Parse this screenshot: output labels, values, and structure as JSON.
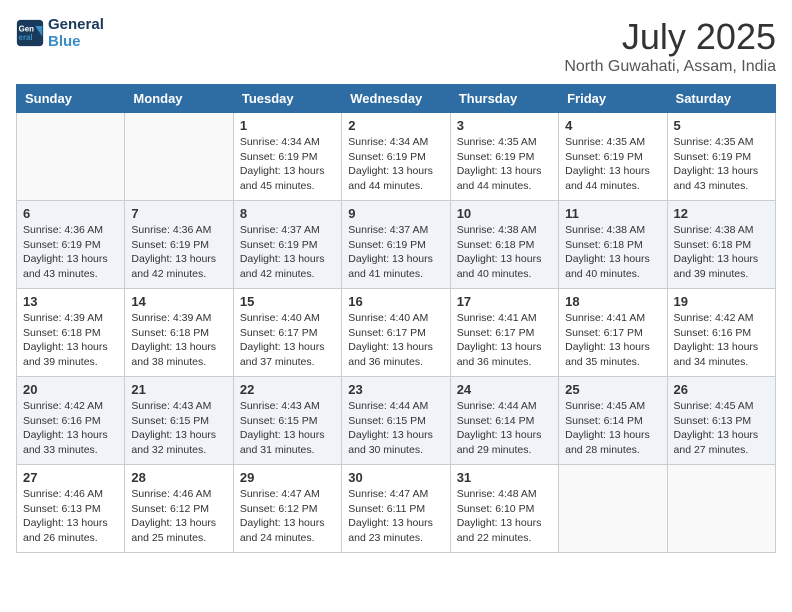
{
  "logo": {
    "line1": "General",
    "line2": "Blue"
  },
  "title": "July 2025",
  "subtitle": "North Guwahati, Assam, India",
  "weekdays": [
    "Sunday",
    "Monday",
    "Tuesday",
    "Wednesday",
    "Thursday",
    "Friday",
    "Saturday"
  ],
  "weeks": [
    [
      {
        "day": "",
        "info": ""
      },
      {
        "day": "",
        "info": ""
      },
      {
        "day": "1",
        "info": "Sunrise: 4:34 AM\nSunset: 6:19 PM\nDaylight: 13 hours and 45 minutes."
      },
      {
        "day": "2",
        "info": "Sunrise: 4:34 AM\nSunset: 6:19 PM\nDaylight: 13 hours and 44 minutes."
      },
      {
        "day": "3",
        "info": "Sunrise: 4:35 AM\nSunset: 6:19 PM\nDaylight: 13 hours and 44 minutes."
      },
      {
        "day": "4",
        "info": "Sunrise: 4:35 AM\nSunset: 6:19 PM\nDaylight: 13 hours and 44 minutes."
      },
      {
        "day": "5",
        "info": "Sunrise: 4:35 AM\nSunset: 6:19 PM\nDaylight: 13 hours and 43 minutes."
      }
    ],
    [
      {
        "day": "6",
        "info": "Sunrise: 4:36 AM\nSunset: 6:19 PM\nDaylight: 13 hours and 43 minutes."
      },
      {
        "day": "7",
        "info": "Sunrise: 4:36 AM\nSunset: 6:19 PM\nDaylight: 13 hours and 42 minutes."
      },
      {
        "day": "8",
        "info": "Sunrise: 4:37 AM\nSunset: 6:19 PM\nDaylight: 13 hours and 42 minutes."
      },
      {
        "day": "9",
        "info": "Sunrise: 4:37 AM\nSunset: 6:19 PM\nDaylight: 13 hours and 41 minutes."
      },
      {
        "day": "10",
        "info": "Sunrise: 4:38 AM\nSunset: 6:18 PM\nDaylight: 13 hours and 40 minutes."
      },
      {
        "day": "11",
        "info": "Sunrise: 4:38 AM\nSunset: 6:18 PM\nDaylight: 13 hours and 40 minutes."
      },
      {
        "day": "12",
        "info": "Sunrise: 4:38 AM\nSunset: 6:18 PM\nDaylight: 13 hours and 39 minutes."
      }
    ],
    [
      {
        "day": "13",
        "info": "Sunrise: 4:39 AM\nSunset: 6:18 PM\nDaylight: 13 hours and 39 minutes."
      },
      {
        "day": "14",
        "info": "Sunrise: 4:39 AM\nSunset: 6:18 PM\nDaylight: 13 hours and 38 minutes."
      },
      {
        "day": "15",
        "info": "Sunrise: 4:40 AM\nSunset: 6:17 PM\nDaylight: 13 hours and 37 minutes."
      },
      {
        "day": "16",
        "info": "Sunrise: 4:40 AM\nSunset: 6:17 PM\nDaylight: 13 hours and 36 minutes."
      },
      {
        "day": "17",
        "info": "Sunrise: 4:41 AM\nSunset: 6:17 PM\nDaylight: 13 hours and 36 minutes."
      },
      {
        "day": "18",
        "info": "Sunrise: 4:41 AM\nSunset: 6:17 PM\nDaylight: 13 hours and 35 minutes."
      },
      {
        "day": "19",
        "info": "Sunrise: 4:42 AM\nSunset: 6:16 PM\nDaylight: 13 hours and 34 minutes."
      }
    ],
    [
      {
        "day": "20",
        "info": "Sunrise: 4:42 AM\nSunset: 6:16 PM\nDaylight: 13 hours and 33 minutes."
      },
      {
        "day": "21",
        "info": "Sunrise: 4:43 AM\nSunset: 6:15 PM\nDaylight: 13 hours and 32 minutes."
      },
      {
        "day": "22",
        "info": "Sunrise: 4:43 AM\nSunset: 6:15 PM\nDaylight: 13 hours and 31 minutes."
      },
      {
        "day": "23",
        "info": "Sunrise: 4:44 AM\nSunset: 6:15 PM\nDaylight: 13 hours and 30 minutes."
      },
      {
        "day": "24",
        "info": "Sunrise: 4:44 AM\nSunset: 6:14 PM\nDaylight: 13 hours and 29 minutes."
      },
      {
        "day": "25",
        "info": "Sunrise: 4:45 AM\nSunset: 6:14 PM\nDaylight: 13 hours and 28 minutes."
      },
      {
        "day": "26",
        "info": "Sunrise: 4:45 AM\nSunset: 6:13 PM\nDaylight: 13 hours and 27 minutes."
      }
    ],
    [
      {
        "day": "27",
        "info": "Sunrise: 4:46 AM\nSunset: 6:13 PM\nDaylight: 13 hours and 26 minutes."
      },
      {
        "day": "28",
        "info": "Sunrise: 4:46 AM\nSunset: 6:12 PM\nDaylight: 13 hours and 25 minutes."
      },
      {
        "day": "29",
        "info": "Sunrise: 4:47 AM\nSunset: 6:12 PM\nDaylight: 13 hours and 24 minutes."
      },
      {
        "day": "30",
        "info": "Sunrise: 4:47 AM\nSunset: 6:11 PM\nDaylight: 13 hours and 23 minutes."
      },
      {
        "day": "31",
        "info": "Sunrise: 4:48 AM\nSunset: 6:10 PM\nDaylight: 13 hours and 22 minutes."
      },
      {
        "day": "",
        "info": ""
      },
      {
        "day": "",
        "info": ""
      }
    ]
  ]
}
